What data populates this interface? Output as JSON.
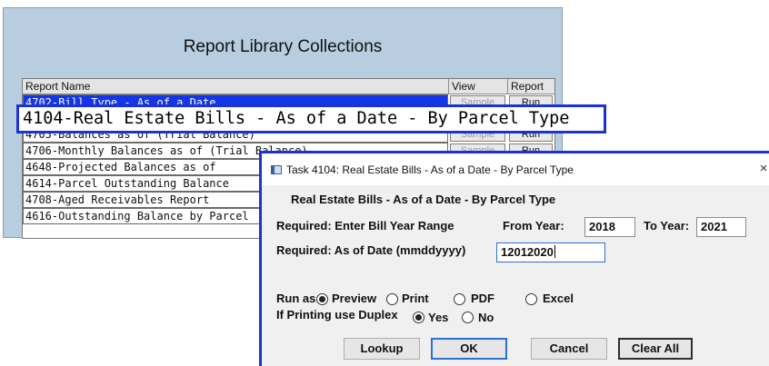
{
  "library": {
    "title": "Report Library Collections",
    "headers": {
      "name": "Report Name",
      "view": "View",
      "report": "Report"
    },
    "rows": [
      {
        "name": "4702-Bill Type - As of a Date",
        "view": "Sample",
        "report": "Run"
      },
      {
        "name": "4705-Balances as of (Trial Balance)",
        "view": "Sample",
        "report": "Run"
      },
      {
        "name": "4706-Monthly Balances as of (Trial Balance)",
        "view": "Sample",
        "report": "Run"
      },
      {
        "name": "4648-Projected Balances as of"
      },
      {
        "name": "4614-Parcel Outstanding Balance"
      },
      {
        "name": "4708-Aged Receivables Report"
      },
      {
        "name": "4616-Outstanding Balance by Parcel"
      }
    ]
  },
  "zoom_label": "4104-Real Estate Bills - As of a Date - By Parcel Type",
  "dialog": {
    "window_title": "Task 4104: Real Estate Bills - As of a Date - By Parcel Type",
    "close_glyph": "×",
    "heading": "Real Estate Bills - As of a Date - By Parcel Type",
    "year_range_label": "Required: Enter Bill Year Range",
    "from_year_label": "From Year:",
    "from_year_value": "2018",
    "to_year_label": "To Year:",
    "to_year_value": "2021",
    "as_of_label": "Required: As of Date (mmddyyyy)",
    "as_of_value": "12012020",
    "run_as_label": "Run as",
    "run_as_options": [
      "Preview",
      "Print",
      "PDF",
      "Excel"
    ],
    "run_as_selected": "Preview",
    "duplex_label": "If Printing use Duplex",
    "duplex_options": [
      "Yes",
      "No"
    ],
    "duplex_selected": "Yes",
    "buttons": {
      "lookup": "Lookup",
      "ok": "OK",
      "cancel": "Cancel",
      "clear_all": "Clear All"
    }
  },
  "colors": {
    "selection": "#1436e6",
    "highlight_border": "#1b33d6",
    "library_bg": "#b8cde0",
    "dialog_bg": "#f0f0f0"
  }
}
